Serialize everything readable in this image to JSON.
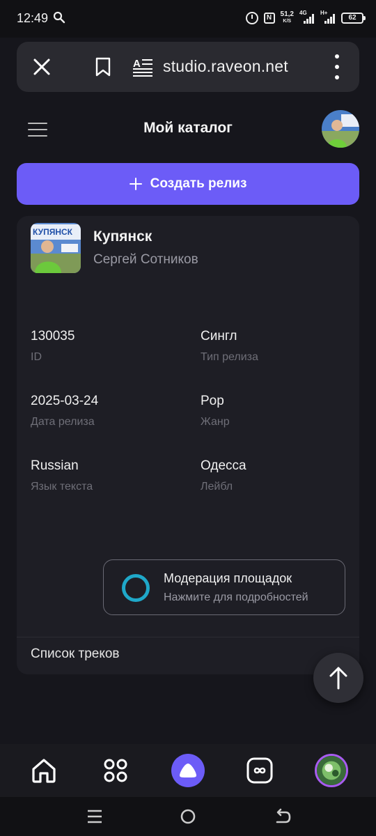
{
  "status_bar": {
    "time": "12:49",
    "net_speed_value": "51,2",
    "net_speed_unit": "K/S",
    "signal_1_label": "4G",
    "signal_2_label": "H+",
    "battery": "62"
  },
  "browser": {
    "url": "studio.raveon.net",
    "icons": [
      "close-icon",
      "bookmark-icon",
      "reader-mode-icon",
      "more-vert-icon"
    ]
  },
  "header": {
    "title": "Мой каталог"
  },
  "create_button": {
    "label": "Создать релиз"
  },
  "release": {
    "title": "Купянск",
    "artist": "Сергей Сотников",
    "cover_text": "КУПЯНСК",
    "fields": [
      {
        "value": "130035",
        "label": "ID"
      },
      {
        "value": "Сингл",
        "label": "Тип релиза"
      },
      {
        "value": "2025-03-24",
        "label": "Дата релиза"
      },
      {
        "value": "Pop",
        "label": "Жанр"
      },
      {
        "value": "Russian",
        "label": "Язык текста"
      },
      {
        "value": "Одесса",
        "label": "Лейбл"
      }
    ],
    "moderation": {
      "title": "Модерация площадок",
      "subtitle": "Нажмите для подробностей"
    },
    "tracks_label": "Список треков"
  },
  "bottom_nav": {
    "items": [
      "home-icon",
      "grid-icon",
      "alice-icon",
      "infinity-icon",
      "profile-avatar"
    ]
  },
  "colors": {
    "accent": "#6c5cf7",
    "moderation_ring": "#1fa8c9",
    "background": "#16161c",
    "card": "#1e1e25"
  }
}
